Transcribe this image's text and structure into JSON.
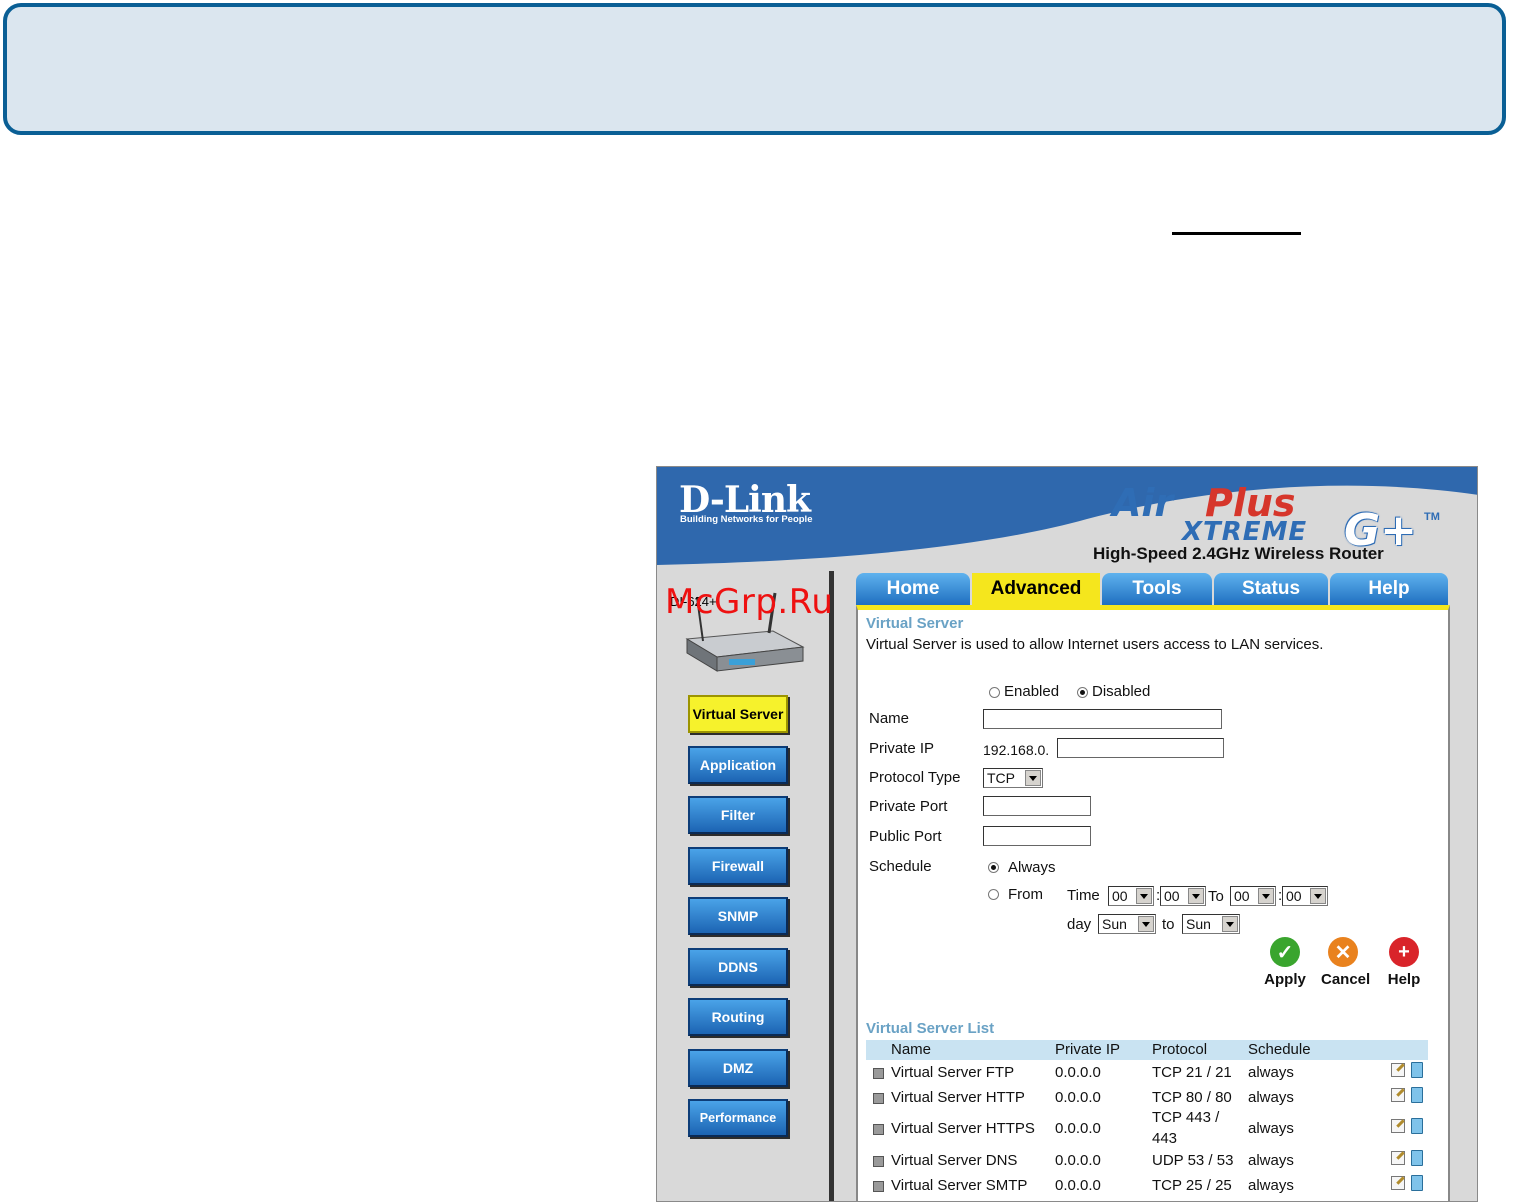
{
  "header": {
    "brand": "D-Link",
    "tagline": "Building Networks for People",
    "product_air": "Air",
    "product_plus": "Plus",
    "product_xtreme": "XTREME",
    "product_gplus": "G+",
    "product_tm": "TM",
    "subtitle": "High-Speed 2.4GHz Wireless Router"
  },
  "watermark": "McGrp.Ru",
  "model": "DI-624+",
  "tabs": [
    {
      "label": "Home"
    },
    {
      "label": "Advanced"
    },
    {
      "label": "Tools"
    },
    {
      "label": "Status"
    },
    {
      "label": "Help"
    }
  ],
  "sidebar": {
    "items": [
      {
        "label": "Virtual Server"
      },
      {
        "label": "Application"
      },
      {
        "label": "Filter"
      },
      {
        "label": "Firewall"
      },
      {
        "label": "SNMP"
      },
      {
        "label": "DDNS"
      },
      {
        "label": "Routing"
      },
      {
        "label": "DMZ"
      },
      {
        "label": "Performance"
      }
    ]
  },
  "form": {
    "title": "Virtual Server",
    "description": "Virtual Server is used to allow Internet users access to LAN services.",
    "enabled_label": "Enabled",
    "disabled_label": "Disabled",
    "selected_state": "Disabled",
    "name_label": "Name",
    "name_value": "",
    "private_ip_label": "Private IP",
    "private_ip_prefix": "192.168.0.",
    "private_ip_value": "",
    "protocol_label": "Protocol Type",
    "protocol_value": "TCP",
    "private_port_label": "Private Port",
    "private_port_value": "",
    "public_port_label": "Public Port",
    "public_port_value": "",
    "schedule_label": "Schedule",
    "always_label": "Always",
    "from_label": "From",
    "selected_schedule": "Always",
    "time_label": "Time",
    "time_from_hour": "00",
    "time_from_min": "00",
    "to_label": "To",
    "time_to_hour": "00",
    "time_to_min": "00",
    "colon": ":",
    "day_label": "day",
    "day_from": "Sun",
    "day_to_label": "to",
    "day_to": "Sun"
  },
  "actions": {
    "apply": "Apply",
    "cancel": "Cancel",
    "help": "Help",
    "apply_color": "#3aa52e",
    "cancel_color": "#e9821e",
    "help_color": "#d9242a"
  },
  "list": {
    "title": "Virtual Server List",
    "columns": [
      "Name",
      "Private IP",
      "Protocol",
      "Schedule"
    ],
    "rows": [
      {
        "name": "Virtual Server FTP",
        "ip": "0.0.0.0",
        "protocol": "TCP 21 / 21",
        "schedule": "always"
      },
      {
        "name": "Virtual Server HTTP",
        "ip": "0.0.0.0",
        "protocol": "TCP 80 / 80",
        "schedule": "always"
      },
      {
        "name": "Virtual Server HTTPS",
        "ip": "0.0.0.0",
        "protocol_line1": "TCP 443 /",
        "protocol_line2": "443",
        "schedule": "always"
      },
      {
        "name": "Virtual Server DNS",
        "ip": "0.0.0.0",
        "protocol": "UDP 53 / 53",
        "schedule": "always"
      },
      {
        "name": "Virtual Server SMTP",
        "ip": "0.0.0.0",
        "protocol": "TCP 25 / 25",
        "schedule": "always"
      }
    ]
  },
  "colors": {
    "banner_border": "#0a5f95",
    "header_blue": "#2f6db5",
    "tab_active": "#f5e61d",
    "section_title": "#6aa2c5"
  }
}
